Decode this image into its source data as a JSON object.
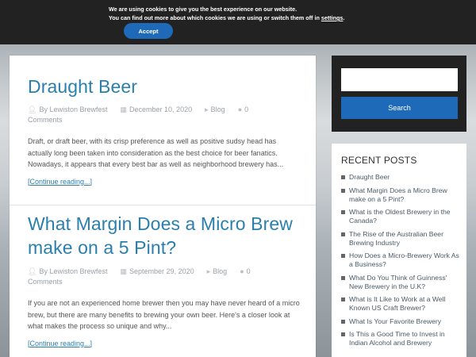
{
  "cookie": {
    "line1": "We are using cookies to give you the best experience on our website.",
    "line2_prefix": "You can find out more about which cookies we are using or switch them off in ",
    "settings_link": "settings",
    "line2_suffix": ".",
    "accept_label": "Accept"
  },
  "posts": [
    {
      "title_lines": [
        "Draught Beer"
      ],
      "author": "By Lewiston Brewfest",
      "date": "December 10, 2020",
      "category": "Blog",
      "comments": "0",
      "comments_label": "Comments",
      "excerpt": "Draft, or draft beer, with its crisp preference as well as positive sudsy head has actually long been taken into consideration as the best choice for beer fanatics. Nowadays, it appears that every best bar as well as neighborhood brewery has...",
      "more": "[Continue reading...]"
    },
    {
      "title_lines": [
        "What Margin Does a Micro Brew",
        "make on a 5 Pint?"
      ],
      "author": "By Lewiston Brewfest",
      "date": "September 29, 2020",
      "category": "Blog",
      "comments": "0",
      "comments_label": "Comments",
      "excerpt": "If you are not an experienced home brewer then you may have never heard of a micro brew, but there are many benefits to brewing your own beer. Here's a closer look at what makes the process so unique and why...",
      "more": "[Continue reading...]"
    }
  ],
  "sidebar": {
    "search_placeholder": "",
    "search_button": "Search",
    "recent_title": "RECENT POSTS",
    "recent_items": [
      "Draught Beer",
      "What Margin Does a Micro Brew make on a 5 Pint?",
      "What is the Oldest Brewery in the Canada?",
      "The Rise of the Australian Beer Brewing Industry",
      "How Does a Micro-Brewery Work As a Business?",
      "What Do You Think of Guinness' New Brewery in the U.K?",
      "What is It Like to Work at a Well Known US Craft Brewer?",
      "What Is Your Favorite Brewery",
      "Is This a Good Time to Invest in Indian Alcohol and Brewery"
    ]
  },
  "icons": {
    "user": "user-icon",
    "calendar": "calendar-icon",
    "folder": "folder-icon",
    "comment": "comment-icon"
  },
  "colors": {
    "accent": "#1e69b8",
    "title_blue": "#2a7fad",
    "dark_bar": "#222222"
  }
}
